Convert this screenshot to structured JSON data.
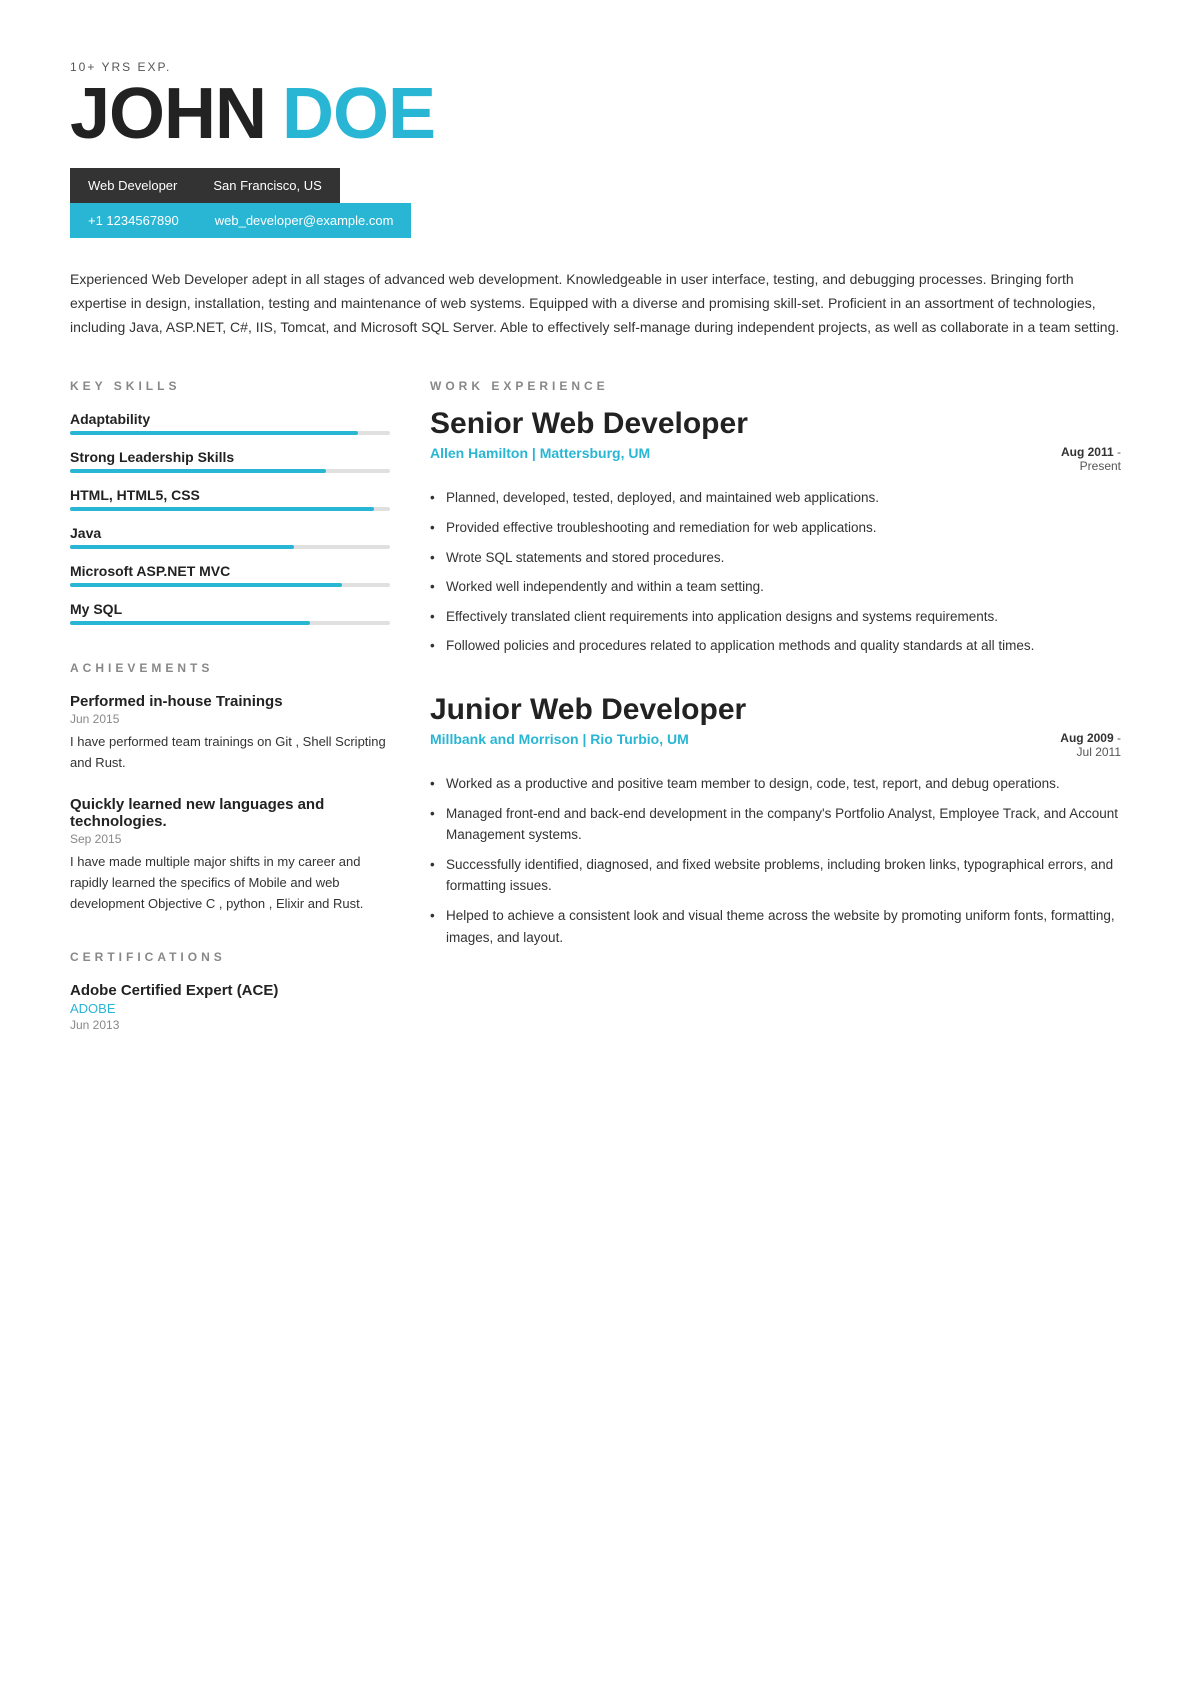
{
  "header": {
    "exp_label": "10+ YRS EXP.",
    "first_name": "JOHN",
    "last_name": "DOE",
    "title": "Web Developer",
    "location": "San Francisco, US",
    "phone": "+1 1234567890",
    "email": "web_developer@example.com"
  },
  "summary": "Experienced Web Developer adept in all stages of advanced web development. Knowledgeable in user interface, testing, and debugging processes. Bringing forth expertise in design, installation, testing and maintenance of web systems. Equipped with a diverse and promising skill-set. Proficient in an assortment of technologies, including Java, ASP.NET, C#, IIS, Tomcat, and Microsoft SQL Server. Able to effectively self-manage during independent projects, as well as collaborate in a team setting.",
  "key_skills": {
    "section_title": "KEY SKILLS",
    "skills": [
      {
        "name": "Adaptability",
        "percent": 90
      },
      {
        "name": "Strong Leadership Skills",
        "percent": 80
      },
      {
        "name": "HTML, HTML5, CSS",
        "percent": 95
      },
      {
        "name": "Java",
        "percent": 70
      },
      {
        "name": "Microsoft ASP.NET MVC",
        "percent": 85
      },
      {
        "name": "My SQL",
        "percent": 75
      }
    ]
  },
  "achievements": {
    "section_title": "ACHIEVEMENTS",
    "items": [
      {
        "title": "Performed in-house Trainings",
        "date": "Jun 2015",
        "description": "I have performed team trainings on Git , Shell Scripting and Rust."
      },
      {
        "title": "Quickly learned new languages and technologies.",
        "date": "Sep 2015",
        "description": "I have made multiple major shifts in my career and rapidly learned the specifics of Mobile and web development Objective C , python , Elixir and Rust."
      }
    ]
  },
  "certifications": {
    "section_title": "CERTIFICATIONS",
    "items": [
      {
        "title": "Adobe Certified Expert (ACE)",
        "issuer": "ADOBE",
        "date": "Jun 2013"
      }
    ]
  },
  "work_experience": {
    "section_title": "WORK EXPERIENCE",
    "jobs": [
      {
        "title": "Senior Web Developer",
        "company": "Allen Hamilton | Mattersburg, UM",
        "date_start": "Aug 2011",
        "date_end": "Present",
        "bullets": [
          "Planned, developed, tested, deployed, and maintained web applications.",
          "Provided effective troubleshooting and remediation for web applications.",
          "Wrote SQL statements and stored procedures.",
          "Worked well independently and within a team setting.",
          "Effectively translated client requirements into application designs and systems requirements.",
          "Followed policies and procedures related to application methods and quality standards at all times."
        ]
      },
      {
        "title": "Junior Web Developer",
        "company": "Millbank and Morrison | Rio Turbio, UM",
        "date_start": "Aug 2009",
        "date_end": "Jul 2011",
        "bullets": [
          "Worked as a productive and positive team member to design, code, test, report, and debug operations.",
          "Managed front-end and back-end development in the company's Portfolio Analyst, Employee Track, and Account Management systems.",
          "Successfully identified, diagnosed, and fixed website problems, including broken links, typographical errors, and formatting issues.",
          "Helped to achieve a consistent look and visual theme across the website by promoting uniform fonts, formatting, images, and layout."
        ]
      }
    ]
  }
}
